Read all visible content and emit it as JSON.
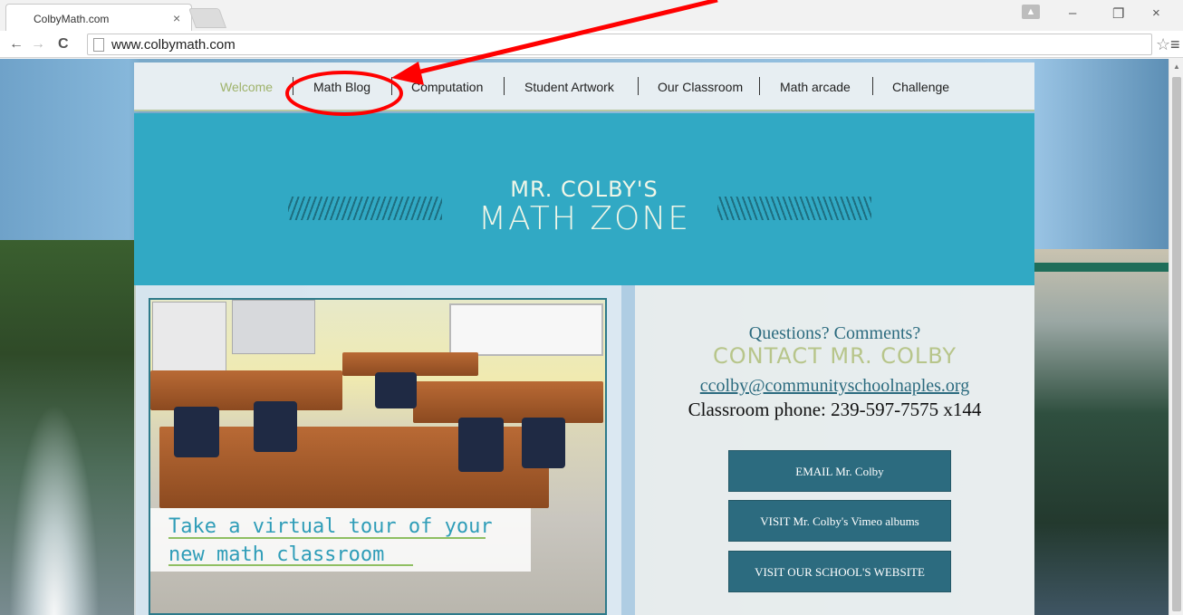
{
  "browser": {
    "tab_title": "ColbyMath.com",
    "tab_close": "×",
    "url": "www.colbymath.com",
    "window_controls": [
      "–",
      "❐",
      "×"
    ],
    "nav_glyphs": {
      "back": "←",
      "forward": "→",
      "reload": "C"
    },
    "star_glyph": "☆",
    "menu_glyph": "≡"
  },
  "site_nav": {
    "items": [
      {
        "label": "Welcome",
        "active": true
      },
      {
        "label": "Math Blog",
        "active": false
      },
      {
        "label": "Computation",
        "active": false
      },
      {
        "label": "Student Artwork",
        "active": false
      },
      {
        "label": "Our Classroom",
        "active": false
      },
      {
        "label": "Math arcade",
        "active": false
      },
      {
        "label": "Challenge",
        "active": false
      }
    ]
  },
  "banner": {
    "line1": "MR. COLBY'S",
    "line2": "MATH ZONE"
  },
  "tour": {
    "line1": "Take a virtual tour of your",
    "line2": "new math classroom"
  },
  "contact": {
    "question": "Questions? Comments?",
    "title": "CONTACT MR. COLBY",
    "email": "ccolby@communityschoolnaples.org",
    "phone": "Classroom phone: 239-597-7575 x144",
    "buttons": [
      "EMAIL Mr. Colby",
      "VISIT Mr. Colby's Vimeo albums",
      "VISIT OUR SCHOOL'S WEBSITE"
    ]
  },
  "colors": {
    "banner": "#31a9c4",
    "nav_active": "#9fb36b",
    "button": "#2c6b7f",
    "annotation": "#ff0000"
  }
}
